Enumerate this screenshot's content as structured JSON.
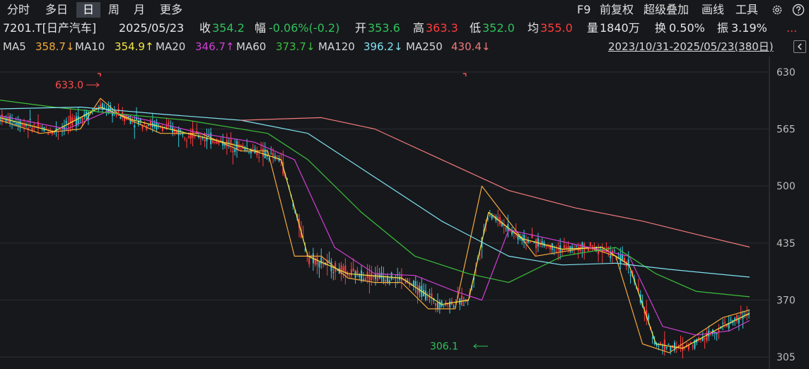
{
  "tabs": [
    {
      "label": "分时",
      "active": false
    },
    {
      "label": "多日",
      "active": false
    },
    {
      "label": "日",
      "active": true
    },
    {
      "label": "周",
      "active": false
    },
    {
      "label": "月",
      "active": false
    },
    {
      "label": "更多",
      "active": false
    }
  ],
  "tools": {
    "f9": "F9",
    "adjust": "前复权",
    "overlay": "超级叠加",
    "draw": "画线",
    "tools": "工具"
  },
  "quote": {
    "name": "7201.T[日产汽车]",
    "date": "2025/05/23",
    "close_label": "收",
    "close": "354.2",
    "change_label": "幅",
    "change": "-0.06%(-0.2)",
    "open_label": "开",
    "open": "353.6",
    "high_label": "高",
    "high": "363.3",
    "low_label": "低",
    "low": "352.0",
    "avg_label": "均",
    "avg": "355.0",
    "vol_label": "量",
    "vol": "1840万",
    "turnover_label": "换",
    "turnover": "0.50%",
    "amp_label": "振",
    "amp": "3.19%",
    "more": "..."
  },
  "ma_labels": [
    {
      "name": "MA5",
      "value": "358.7↓",
      "color": "#f2a93b"
    },
    {
      "name": "MA10",
      "value": "354.9↑",
      "color": "#f5e642"
    },
    {
      "name": "MA20",
      "value": "346.7↑",
      "color": "#d13fd4"
    },
    {
      "name": "MA60",
      "value": "373.7↓",
      "color": "#3bbf3b"
    },
    {
      "name": "MA120",
      "value": "396.2↓",
      "color": "#7fe3f0"
    },
    {
      "name": "MA250",
      "value": "430.4↓",
      "color": "#f07a7a"
    }
  ],
  "range_text": "2023/10/31-2025/05/23(380日)",
  "colors": {
    "up": "#ff3b3b",
    "down": "#33c8d8",
    "green": "#2fc25b",
    "grid": "#2a2c33",
    "bg": "#17181c",
    "axis_text": "#bdbdbd",
    "annot": "#ff4d4d"
  },
  "chart_data": {
    "type": "line",
    "y_ticks": [
      305,
      370,
      435,
      500,
      565,
      630
    ],
    "ylim": [
      293,
      646
    ],
    "x_range": [
      "2023/10/31",
      "2025/05/23"
    ],
    "n_days": 380,
    "annotations": [
      {
        "text": "633.0",
        "day": 75,
        "value": 633.0,
        "type": "max"
      },
      {
        "text": "306.1",
        "day": 355,
        "value": 306.1,
        "type": "min"
      }
    ],
    "series": [
      {
        "name": "MA5",
        "color": "#f2a93b",
        "values": [
          [
            0,
            575
          ],
          [
            30,
            560
          ],
          [
            60,
            565
          ],
          [
            75,
            600
          ],
          [
            90,
            580
          ],
          [
            120,
            560
          ],
          [
            150,
            560
          ],
          [
            180,
            540
          ],
          [
            200,
            540
          ],
          [
            220,
            420
          ],
          [
            240,
            420
          ],
          [
            260,
            395
          ],
          [
            280,
            390
          ],
          [
            300,
            390
          ],
          [
            320,
            360
          ],
          [
            340,
            360
          ],
          [
            360,
            500
          ],
          [
            380,
            460
          ],
          [
            400,
            420
          ],
          [
            420,
            425
          ],
          [
            440,
            430
          ],
          [
            460,
            420
          ],
          [
            480,
            320
          ],
          [
            500,
            310
          ],
          [
            520,
            330
          ],
          [
            540,
            350
          ],
          [
            560,
            358.7
          ]
        ]
      },
      {
        "name": "MA10",
        "color": "#f5e642",
        "values": [
          [
            0,
            578
          ],
          [
            40,
            562
          ],
          [
            75,
            590
          ],
          [
            100,
            575
          ],
          [
            140,
            560
          ],
          [
            180,
            545
          ],
          [
            210,
            530
          ],
          [
            230,
            420
          ],
          [
            260,
            400
          ],
          [
            300,
            395
          ],
          [
            330,
            365
          ],
          [
            350,
            370
          ],
          [
            365,
            470
          ],
          [
            390,
            440
          ],
          [
            420,
            428
          ],
          [
            450,
            430
          ],
          [
            470,
            410
          ],
          [
            490,
            320
          ],
          [
            510,
            315
          ],
          [
            540,
            340
          ],
          [
            560,
            354.9
          ]
        ]
      },
      {
        "name": "MA20",
        "color": "#d13fd4",
        "values": [
          [
            0,
            580
          ],
          [
            50,
            565
          ],
          [
            80,
            585
          ],
          [
            110,
            575
          ],
          [
            150,
            560
          ],
          [
            190,
            550
          ],
          [
            220,
            530
          ],
          [
            250,
            430
          ],
          [
            280,
            400
          ],
          [
            310,
            398
          ],
          [
            340,
            380
          ],
          [
            360,
            370
          ],
          [
            380,
            450
          ],
          [
            410,
            440
          ],
          [
            440,
            430
          ],
          [
            470,
            420
          ],
          [
            495,
            340
          ],
          [
            520,
            330
          ],
          [
            545,
            335
          ],
          [
            560,
            346.7
          ]
        ]
      },
      {
        "name": "MA60",
        "color": "#3bbf3b",
        "values": [
          [
            0,
            598
          ],
          [
            40,
            590
          ],
          [
            90,
            582
          ],
          [
            140,
            575
          ],
          [
            200,
            560
          ],
          [
            230,
            530
          ],
          [
            270,
            470
          ],
          [
            310,
            420
          ],
          [
            350,
            400
          ],
          [
            380,
            390
          ],
          [
            420,
            420
          ],
          [
            460,
            430
          ],
          [
            490,
            400
          ],
          [
            520,
            380
          ],
          [
            560,
            373.7
          ]
        ]
      },
      {
        "name": "MA120",
        "color": "#7fe3f0",
        "values": [
          [
            0,
            588
          ],
          [
            60,
            590
          ],
          [
            120,
            582
          ],
          [
            180,
            575
          ],
          [
            230,
            560
          ],
          [
            280,
            510
          ],
          [
            330,
            460
          ],
          [
            380,
            420
          ],
          [
            420,
            410
          ],
          [
            460,
            412
          ],
          [
            500,
            405
          ],
          [
            560,
            396.2
          ]
        ]
      },
      {
        "name": "MA250",
        "color": "#f07a7a",
        "values": [
          [
            180,
            575
          ],
          [
            240,
            578
          ],
          [
            280,
            565
          ],
          [
            330,
            530
          ],
          [
            380,
            495
          ],
          [
            430,
            475
          ],
          [
            480,
            460
          ],
          [
            520,
            445
          ],
          [
            560,
            430.4
          ]
        ]
      }
    ]
  }
}
